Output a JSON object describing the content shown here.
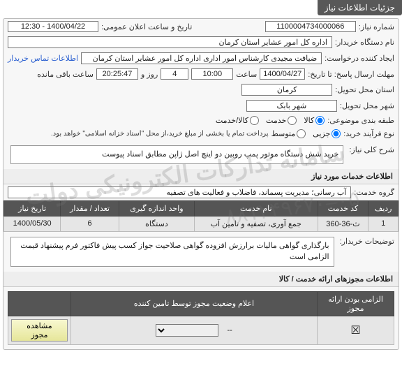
{
  "header": {
    "tab": "جزئیات اطلاعات نیاز"
  },
  "fields": {
    "need_no_label": "شماره نیاز:",
    "need_no": "1100004734000066",
    "announce_label": "تاریخ و ساعت اعلان عمومی:",
    "announce_value": "1400/04/22 - 12:30",
    "buyer_label": "نام دستگاه خریدار:",
    "buyer_value": "اداره کل امور عشایر استان کرمان",
    "requester_label": "ایجاد کننده درخواست:",
    "requester_value": "ضیافت مجیدی کارشناس امور اداری اداره کل امور عشایر استان کرمان",
    "contact_link": "اطلاعات تماس خریدار",
    "deadline_label": "مهلت ارسال پاسخ: تا تاریخ:",
    "deadline_date": "1400/04/27",
    "time_label": "ساعت",
    "deadline_time": "10:00",
    "days": "4",
    "days_and": "روز و",
    "remain_time": "20:25:47",
    "remain_label": "ساعت باقی مانده",
    "province_label": "استان محل تحویل:",
    "province": "کرمان",
    "city_label": "شهر محل تحویل:",
    "city": "شهر بابک",
    "subject_cat_label": "طبقه بندی موضوعی:",
    "subject_cat": {
      "o1": "کالا",
      "o2": "خدمت",
      "o3": "کالا/خدمت"
    },
    "process_label": "نوع فرآیند خرید:",
    "process": {
      "o1": "جزیی",
      "o2": "متوسط"
    },
    "process_note": "پرداخت تمام یا بخشی از مبلغ خرید،از محل \"اسناد خزانه اسلامی\" خواهد بود.",
    "main_desc_label": "شرح کلی نیاز:",
    "main_desc": "خرید شش دستگاه موتور پمپ روبین دو اینچ اصل ژاپن مطابق اسناد پیوست",
    "services_section": "اطلاعات خدمات مورد نیاز",
    "service_group_label": "گروه خدمت:",
    "service_group": "آب رسانی؛ مدیریت پسماند، فاضلاب و فعالیت های تصفیه",
    "table": {
      "h1": "ردیف",
      "h2": "کد خدمت",
      "h3": "نام خدمت",
      "h4": "واحد اندازه گیری",
      "h5": "تعداد / مقدار",
      "h6": "تاریخ نیاز",
      "r1c1": "1",
      "r1c2": "ث-36-360",
      "r1c3": "جمع آوری، تصفیه و تامین آب",
      "r1c4": "دستگاه",
      "r1c5": "6",
      "r1c6": "1400/05/30"
    },
    "buyer_note_label": "توضیحات خریدار:",
    "buyer_note": "بارگذاری گواهی مالیات برارزش افزوده گواهی صلاحیت جواز کسب پیش فاکتور فرم پیشنهاد قیمت الزامی است",
    "permits_section": "اطلاعات مجوزهای ارائه خدمت / کالا",
    "permits_table": {
      "h1": "الزامی بودن ارائه مجوز",
      "h2": "اعلام وضعیت مجوز توسط تامین کننده",
      "r1c2": "--",
      "view_btn": "مشاهده مجوز"
    }
  },
  "watermark": {
    "line1": "سامانه تدارکات الکترونیکی دولت",
    "line2": "۰۵–۸۸۱۲۴۹۶۷۰"
  }
}
